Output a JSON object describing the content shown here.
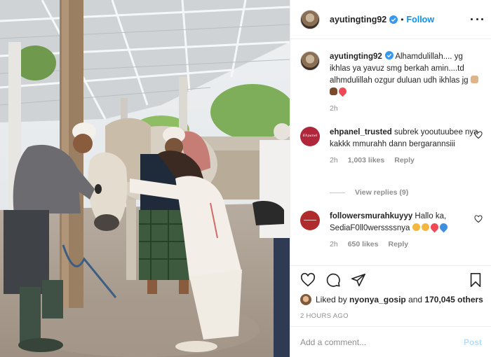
{
  "post": {
    "owner": "ayutingting92",
    "follow_label": "Follow",
    "separator": "•"
  },
  "caption": {
    "username": "ayutingting92",
    "text": " Alhamdulillah.... yg ikhlas ya yavuz smg berkah amin....td alhmdulillah ozgur duluan udh ikhlas jg ",
    "time": "2h"
  },
  "comments": [
    {
      "username": "ehpanel_trusted",
      "text": " subrek yooutuubee nya kakkk mmurahh dann bergarannsiii",
      "time": "2h",
      "likes": "1,003 likes",
      "reply_label": "Reply"
    },
    {
      "username": "followersmurahkuyyy",
      "text": " Hallo ka, SediaF0ll0werssssnya",
      "time": "2h",
      "likes": "650 likes",
      "reply_label": "Reply"
    }
  ],
  "view_replies_label": "View replies (9)",
  "likes_summary": {
    "prefix": "Liked by ",
    "user": "nyonya_gosip",
    "middle": " and ",
    "count": "170,045 others"
  },
  "posted_ago": "2 HOURS AGO",
  "comment_box": {
    "placeholder": "Add a comment...",
    "post_label": "Post"
  },
  "icons": {
    "verified": "verified-badge-icon",
    "like": "heart-icon",
    "comment": "comment-bubble-icon",
    "share": "paper-plane-icon",
    "save": "bookmark-icon",
    "more": "more-options-icon"
  },
  "colors": {
    "accent": "#0095f6",
    "verified": "#3897f0",
    "muted": "#8e8e8e",
    "border": "#efefef"
  }
}
